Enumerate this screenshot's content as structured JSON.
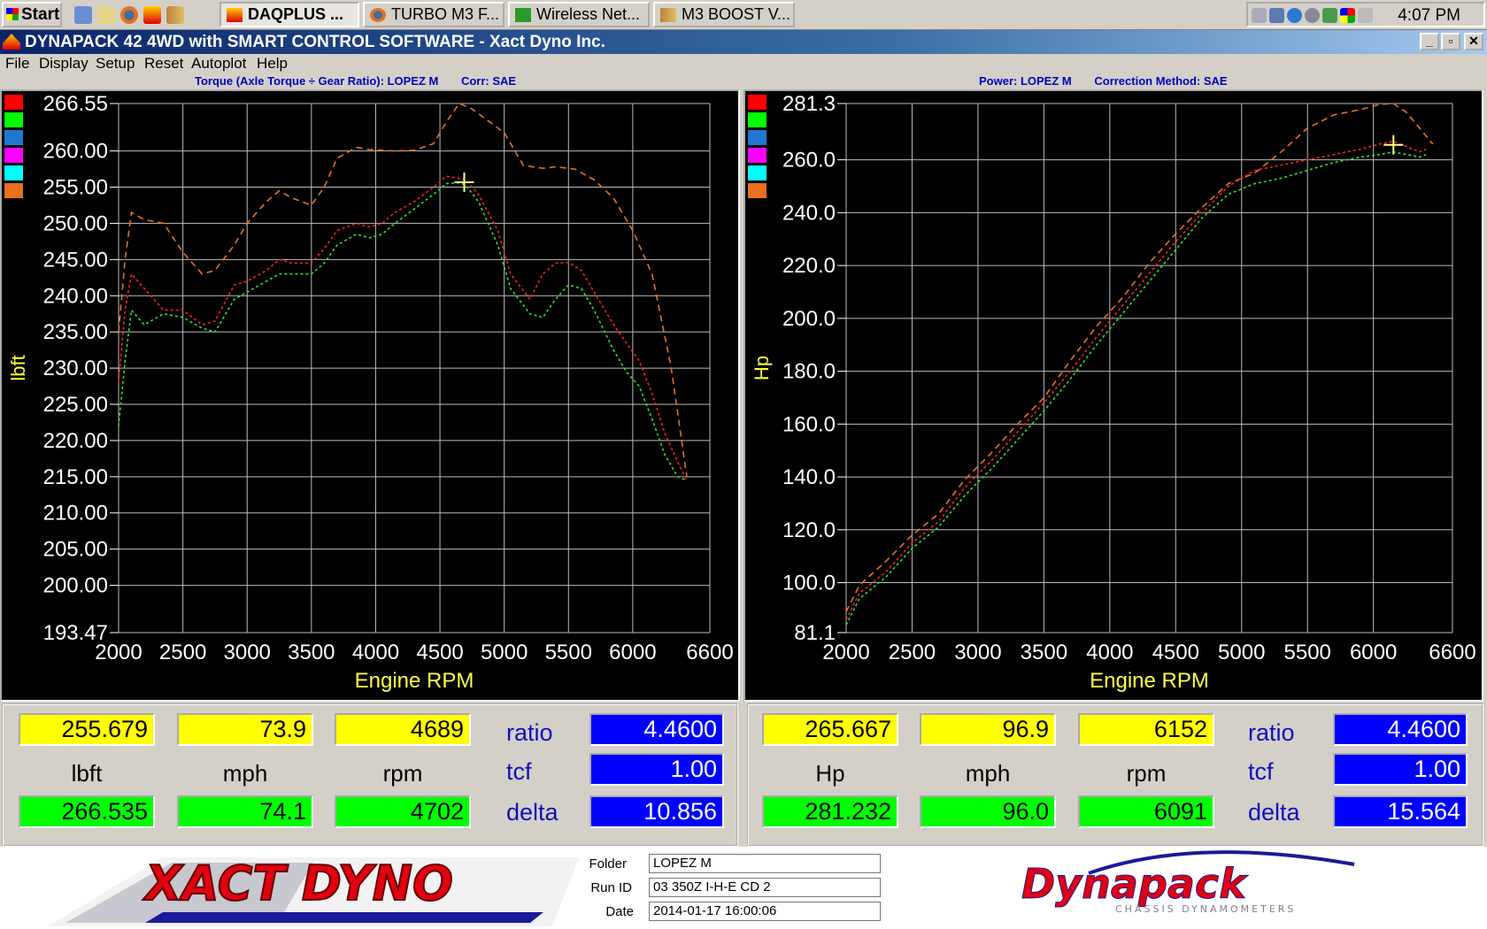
{
  "taskbar": {
    "start_label": "Start",
    "buttons": [
      {
        "label": "DAQPLUS ..."
      },
      {
        "label": "TURBO M3 F..."
      },
      {
        "label": "Wireless Net..."
      },
      {
        "label": "M3 BOOST V..."
      }
    ],
    "clock": "4:07 PM"
  },
  "window": {
    "title": "DYNAPACK 42 4WD with SMART CONTROL SOFTWARE - Xact Dyno Inc.",
    "minimize": "_",
    "maximize": "▫",
    "close": "✕"
  },
  "menu": [
    "File",
    "Display",
    "Setup",
    "Reset",
    "Autoplot",
    "Help"
  ],
  "torque_chart": {
    "header_left": "Torque (Axle Torque ÷ Gear Ratio): LOPEZ M",
    "header_right": "Corr: SAE"
  },
  "power_chart": {
    "header_left": "Power: LOPEZ M",
    "header_right": "Correction Method: SAE"
  },
  "swatch_colors": [
    "#ff0000",
    "#00ff00",
    "#1e78d2",
    "#ff00ff",
    "#00ffff",
    "#e87020"
  ],
  "chart_data": [
    {
      "type": "line",
      "title": "Torque (Axle Torque ÷ Gear Ratio): LOPEZ M",
      "xlabel": "Engine RPM",
      "ylabel": "lbft",
      "xlim": [
        2000,
        6600
      ],
      "ylim": [
        193.47,
        266.55
      ],
      "xticks": [
        "2000",
        "2500",
        "3000",
        "3500",
        "4000",
        "4500",
        "5000",
        "5500",
        "6000",
        "6600"
      ],
      "yticks": [
        "266.55",
        "260.00",
        "255.00",
        "250.00",
        "245.00",
        "240.00",
        "235.00",
        "230.00",
        "225.00",
        "220.00",
        "215.00",
        "210.00",
        "205.00",
        "200.00",
        "193.47"
      ],
      "grid": true,
      "series": [
        {
          "color": "#e87020",
          "dash": "7,5",
          "x": [
            2000,
            2050,
            2100,
            2200,
            2350,
            2500,
            2650,
            2750,
            2900,
            3000,
            3150,
            3250,
            3350,
            3500,
            3600,
            3700,
            3850,
            3950,
            4050,
            4150,
            4300,
            4450,
            4550,
            4650,
            4750,
            4850,
            5000,
            5150,
            5300,
            5400,
            5550,
            5700,
            5850,
            6000,
            6150,
            6300,
            6420
          ],
          "y": [
            235,
            245,
            251.5,
            250.5,
            250,
            246,
            243,
            243.5,
            247,
            250,
            253,
            254.5,
            253.5,
            252.5,
            255,
            259,
            260.5,
            260.2,
            260.1,
            260,
            260.1,
            261,
            264,
            266.55,
            265.8,
            264.5,
            262.5,
            258,
            257.6,
            257.8,
            257.5,
            256,
            253.5,
            249,
            243,
            230,
            215
          ]
        },
        {
          "color": "#ff2020",
          "dash": "3,3",
          "x": [
            2000,
            2050,
            2100,
            2200,
            2350,
            2500,
            2650,
            2750,
            2900,
            3000,
            3150,
            3250,
            3350,
            3500,
            3600,
            3700,
            3850,
            3950,
            4050,
            4150,
            4300,
            4450,
            4550,
            4650,
            4700,
            4800,
            4950,
            5050,
            5200,
            5300,
            5400,
            5500,
            5600,
            5700,
            5850,
            5950,
            6050,
            6150,
            6250,
            6350,
            6420
          ],
          "y": [
            228,
            238,
            243,
            241,
            238,
            238,
            236,
            236.5,
            241.5,
            242,
            243.5,
            245,
            244.5,
            244.5,
            246.5,
            249,
            250,
            249.5,
            250,
            251.5,
            253,
            255,
            256.5,
            256.2,
            256,
            254,
            249,
            243,
            239.5,
            243,
            244.5,
            244.6,
            243.5,
            240.5,
            236,
            233.5,
            231,
            226.5,
            221,
            217,
            214.5
          ]
        },
        {
          "color": "#30e030",
          "dash": "3,3",
          "x": [
            2000,
            2050,
            2100,
            2200,
            2350,
            2500,
            2650,
            2750,
            2900,
            3000,
            3150,
            3250,
            3350,
            3500,
            3600,
            3700,
            3850,
            3950,
            4050,
            4150,
            4300,
            4450,
            4550,
            4650,
            4700,
            4800,
            4950,
            5050,
            5200,
            5300,
            5400,
            5500,
            5600,
            5700,
            5850,
            5950,
            6050,
            6150,
            6250,
            6350,
            6420
          ],
          "y": [
            222,
            231,
            238,
            236,
            237.5,
            237,
            235.5,
            235,
            239.5,
            240.5,
            242,
            243,
            243,
            243,
            244.5,
            247,
            248.5,
            248,
            248.5,
            250,
            252,
            254,
            255.5,
            255.6,
            255.3,
            253,
            247,
            241,
            237.5,
            237,
            239.5,
            241.5,
            241,
            238,
            232.5,
            229.5,
            227.5,
            223,
            218,
            215,
            214.5
          ]
        }
      ],
      "cursor": {
        "x": 4689,
        "y": 255.679
      }
    },
    {
      "type": "line",
      "title": "Power: LOPEZ M",
      "xlabel": "Engine RPM",
      "ylabel": "Hp",
      "xlim": [
        2000,
        6600
      ],
      "ylim": [
        81.1,
        281.3
      ],
      "xticks": [
        "2000",
        "2500",
        "3000",
        "3500",
        "4000",
        "4500",
        "5000",
        "5500",
        "6000",
        "6600"
      ],
      "yticks": [
        "281.3",
        "260.0",
        "240.0",
        "220.0",
        "200.0",
        "180.0",
        "160.0",
        "140.0",
        "120.0",
        "100.0",
        "81.1"
      ],
      "grid": true,
      "series": [
        {
          "color": "#e87020",
          "dash": "7,5",
          "x": [
            2000,
            2100,
            2300,
            2500,
            2700,
            2900,
            3100,
            3300,
            3500,
            3700,
            3900,
            4100,
            4300,
            4500,
            4700,
            4900,
            5100,
            5300,
            5500,
            5700,
            5900,
            6050,
            6150,
            6250,
            6350,
            6450
          ],
          "y": [
            89,
            99,
            108,
            118,
            126,
            139,
            149,
            160,
            170,
            184,
            197,
            208,
            221,
            232,
            242,
            251,
            255,
            263,
            272,
            277,
            279,
            281,
            281.3,
            278,
            272,
            266
          ]
        },
        {
          "color": "#ff2020",
          "dash": "3,3",
          "x": [
            2000,
            2100,
            2300,
            2500,
            2700,
            2900,
            3100,
            3300,
            3500,
            3700,
            3900,
            4100,
            4300,
            4500,
            4700,
            4900,
            5100,
            5300,
            5500,
            5700,
            5900,
            6050,
            6150,
            6250,
            6350,
            6400
          ],
          "y": [
            86,
            96,
            104,
            115,
            123,
            136,
            146,
            157,
            168,
            180,
            193,
            205,
            217,
            229,
            240,
            250,
            256,
            258,
            260,
            262,
            264,
            266,
            267,
            265,
            263,
            264
          ]
        },
        {
          "color": "#30e030",
          "dash": "3,3",
          "x": [
            2000,
            2100,
            2300,
            2500,
            2700,
            2900,
            3100,
            3300,
            3500,
            3700,
            3900,
            4100,
            4300,
            4500,
            4700,
            4900,
            5100,
            5300,
            5500,
            5700,
            5900,
            6050,
            6150,
            6250,
            6350,
            6400
          ],
          "y": [
            84,
            94,
            102,
            113,
            121,
            133,
            143,
            154,
            165,
            177,
            190,
            202,
            214,
            226,
            238,
            247,
            251,
            253,
            256,
            259,
            261,
            262,
            263,
            262,
            261,
            262
          ]
        }
      ],
      "cursor": {
        "x": 6152,
        "y": 265.667
      }
    }
  ],
  "readouts": {
    "left": {
      "top_values": [
        "255.679",
        "73.9",
        "4689"
      ],
      "units": [
        "lbft",
        "mph",
        "rpm"
      ],
      "bottom_values": [
        "266.535",
        "74.1",
        "4702"
      ],
      "labels": [
        "ratio",
        "tcf",
        "delta"
      ],
      "blue_values": [
        "4.4600",
        "1.00",
        "10.856"
      ]
    },
    "right": {
      "top_values": [
        "265.667",
        "96.9",
        "6152"
      ],
      "units": [
        "Hp",
        "mph",
        "rpm"
      ],
      "bottom_values": [
        "281.232",
        "96.0",
        "6091"
      ],
      "labels": [
        "ratio",
        "tcf",
        "delta"
      ],
      "blue_values": [
        "4.4600",
        "1.00",
        "15.564"
      ]
    }
  },
  "footer": {
    "folder_label": "Folder",
    "folder_value": "LOPEZ M",
    "runid_label": "Run ID",
    "runid_value": "03 350Z I-H-E CD 2",
    "date_label": "Date",
    "date_value": "2014-01-17 16:00:06",
    "xact_logo_text": "XACT DYNO",
    "dynapack_logo_text": "Dynapack",
    "dynapack_sub": "CHASSIS DYNAMOMETERS"
  }
}
